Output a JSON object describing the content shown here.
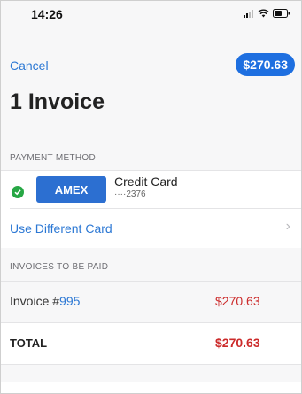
{
  "status_bar": {
    "time": "14:26"
  },
  "nav": {
    "cancel_label": "Cancel",
    "pay_amount": "$270.63"
  },
  "title": "1 Invoice",
  "payment_method": {
    "header": "PAYMENT METHOD",
    "card_brand": "AMEX",
    "card_type": "Credit Card",
    "card_number": "····2376",
    "use_different_label": "Use Different Card"
  },
  "invoices": {
    "header": "INVOICES TO BE PAID",
    "rows": [
      {
        "label_prefix": "Invoice #",
        "number": "995",
        "amount": "$270.63"
      }
    ],
    "total_label": "TOTAL",
    "total_amount": "$270.63"
  },
  "colors": {
    "accent": "#1e6fe0",
    "link": "#2c78d4",
    "amount": "#cc2b2b",
    "check": "#27a745"
  }
}
